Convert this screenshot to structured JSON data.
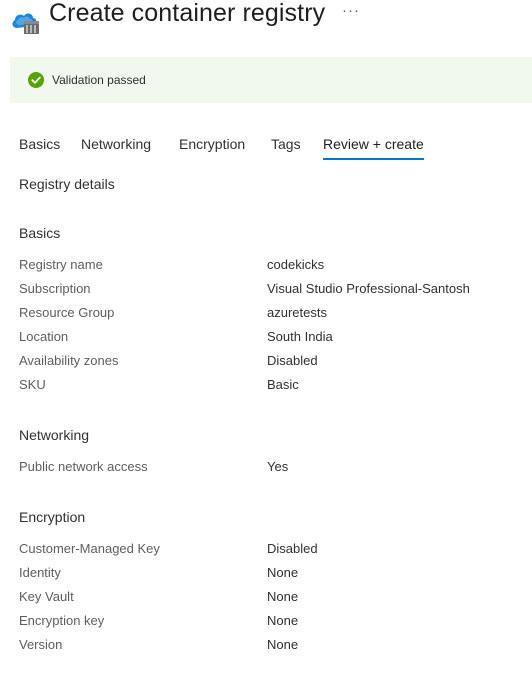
{
  "header": {
    "title": "Create container registry",
    "more_label": "···"
  },
  "banner": {
    "message": "Validation passed",
    "status_color": "#57a300"
  },
  "tabs": [
    {
      "label": "Basics",
      "active": false
    },
    {
      "label": "Networking",
      "active": false
    },
    {
      "label": "Encryption",
      "active": false
    },
    {
      "label": "Tags",
      "active": false
    },
    {
      "label": "Review + create",
      "active": true
    }
  ],
  "accent_color": "#0078d4",
  "registry_details_heading": "Registry details",
  "basics": {
    "heading": "Basics",
    "rows": [
      {
        "label": "Registry name",
        "value": "codekicks"
      },
      {
        "label": "Subscription",
        "value": "Visual Studio Professional-Santosh"
      },
      {
        "label": "Resource Group",
        "value": "azuretests"
      },
      {
        "label": "Location",
        "value": "South India"
      },
      {
        "label": "Availability zones",
        "value": "Disabled"
      },
      {
        "label": "SKU",
        "value": "Basic"
      }
    ]
  },
  "networking": {
    "heading": "Networking",
    "rows": [
      {
        "label": "Public network access",
        "value": "Yes"
      }
    ]
  },
  "encryption": {
    "heading": "Encryption",
    "rows": [
      {
        "label": "Customer-Managed Key",
        "value": "Disabled"
      },
      {
        "label": "Identity",
        "value": "None"
      },
      {
        "label": "Key Vault",
        "value": "None"
      },
      {
        "label": "Encryption key",
        "value": "None"
      },
      {
        "label": "Version",
        "value": "None"
      }
    ]
  }
}
